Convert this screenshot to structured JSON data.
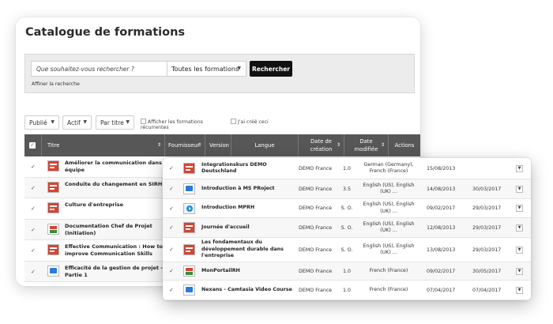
{
  "page": {
    "title": "Catalogue de formations"
  },
  "search": {
    "placeholder": "Que souhaitez-vous rechercher ?",
    "scope": "Toutes les formations",
    "button": "Rechercher",
    "refine": "Affiner la recherche"
  },
  "filters": {
    "published": "Publié",
    "active": "Actif",
    "sort": "Par titre",
    "recurrent": "Afficher les formations récurrentes",
    "mine": "J'ai créé ceci"
  },
  "columns": {
    "title": "Titre",
    "provider": "Fournisseur",
    "version": "Version",
    "language": "Langue",
    "created": "Date de création",
    "modified": "Date modifiée",
    "actions": "Actions"
  },
  "back_rows": [
    {
      "title": "Améliorer la communication dans mon équipe",
      "icon": "document-icon",
      "checked": true
    },
    {
      "title": "Conduite du changement en SIRH",
      "icon": "document-icon",
      "checked": true
    },
    {
      "title": "Culture d'entreprise",
      "icon": "document-icon",
      "checked": true
    },
    {
      "title": "Documentation Chef de Projet (Initiation)",
      "icon": "books-icon",
      "checked": true
    },
    {
      "title": "Effective Communication : How to improve Communication Skills",
      "icon": "document-icon",
      "checked": true
    },
    {
      "title": "Efficacité de la gestion de projet - Partie 1",
      "icon": "screen-icon",
      "checked": true
    }
  ],
  "front_rows": [
    {
      "title": "Integrationskurs DEMO Deutschland",
      "icon": "document-icon",
      "provider": "DEMO France",
      "version": "1.0",
      "language": "German (Germany), French (France)",
      "created": "15/08/2013",
      "modified": ""
    },
    {
      "title": "Introduction à MS PRoject",
      "icon": "screen-icon",
      "provider": "DEMO France",
      "version": "3.5",
      "language": "English (US), English (UK) ...",
      "created": "14/08/2013",
      "modified": "30/03/2017"
    },
    {
      "title": "Introduction MPRH",
      "icon": "video-icon",
      "provider": "DEMO France",
      "version": "S. O.",
      "language": "English (US), English (UK) ...",
      "created": "09/02/2017",
      "modified": "29/03/2017"
    },
    {
      "title": "Journée d'accueil",
      "icon": "document-icon",
      "provider": "DEMO France",
      "version": "S. O.",
      "language": "English (US), English (UK) ...",
      "created": "12/08/2013",
      "modified": "29/03/2017"
    },
    {
      "title": "Les fondamentaux du développement durable dans l'entreprise",
      "icon": "document-icon",
      "provider": "DEMO France",
      "version": "S. O.",
      "language": "English (US), English (UK) ...",
      "created": "13/08/2013",
      "modified": "29/03/2017"
    },
    {
      "title": "MonPortailRH",
      "icon": "books-icon",
      "provider": "DEMO France",
      "version": "1.0",
      "language": "French (France)",
      "created": "09/02/2017",
      "modified": "30/05/2017"
    },
    {
      "title": "Nexans - Camtasia Video Course",
      "icon": "screen-icon",
      "provider": "DEMO France",
      "version": "1.0",
      "language": "French (France)",
      "created": "07/04/2017",
      "modified": "07/04/2017"
    }
  ]
}
